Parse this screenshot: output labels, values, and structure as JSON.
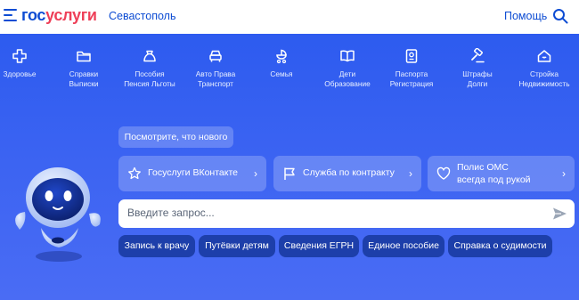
{
  "header": {
    "brand_part1": "гос",
    "brand_part2": "услуги",
    "city": "Севастополь",
    "help_label": "Помощь",
    "menu_icon": "hamburger-icon",
    "search_icon": "search-icon",
    "colors": {
      "brand_blue": "#0d4cd3",
      "brand_red": "#ee3f58",
      "hero_bg": "#2f5cf0"
    }
  },
  "categories": [
    {
      "icon": "health-icon",
      "line1": "Здоровье",
      "line2": ""
    },
    {
      "icon": "folder-icon",
      "line1": "Справки",
      "line2": "Выписки"
    },
    {
      "icon": "benefits-icon",
      "line1": "Пособия",
      "line2": "Пенсия Льготы"
    },
    {
      "icon": "car-icon",
      "line1": "Авто Права",
      "line2": "Транспорт"
    },
    {
      "icon": "stroller-icon",
      "line1": "Семья",
      "line2": ""
    },
    {
      "icon": "book-icon",
      "line1": "Дети",
      "line2": "Образование"
    },
    {
      "icon": "passport-icon",
      "line1": "Паспорта",
      "line2": "Регистрация"
    },
    {
      "icon": "gavel-icon",
      "line1": "Штрафы",
      "line2": "Долги"
    },
    {
      "icon": "house-icon",
      "line1": "Стройка",
      "line2": "Недвижимость"
    }
  ],
  "news_label": "Посмотрите, что нового",
  "cards": [
    {
      "icon": "star-icon",
      "line1": "Госуслуги ВКонтакте",
      "line2": ""
    },
    {
      "icon": "flag-icon",
      "line1": "Служба по контракту",
      "line2": ""
    },
    {
      "icon": "heart-icon",
      "line1": "Полис ОМС",
      "line2": "всегда под рукой"
    }
  ],
  "search": {
    "placeholder": "Введите запрос...",
    "send_icon": "send-icon"
  },
  "chips": [
    "Запись к врачу",
    "Путёвки детям",
    "Сведения ЕГРН",
    "Единое пособие",
    "Справка о судимости"
  ],
  "assistant_icon": "robot-assistant-icon"
}
